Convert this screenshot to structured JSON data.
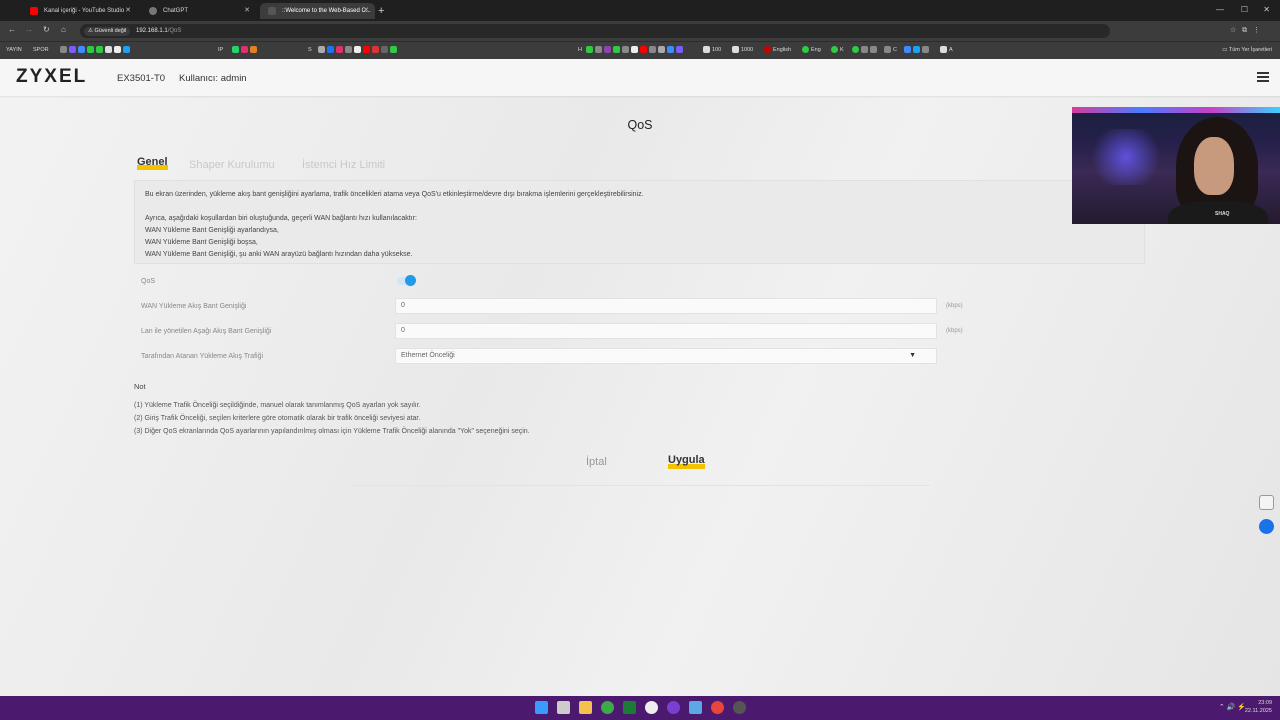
{
  "browser": {
    "tabs": [
      {
        "title": "Kanal içeriği - YouTube Studio",
        "color": "#ff0000"
      },
      {
        "title": "ChatGPT",
        "color": "#777777"
      },
      {
        "title": "::Welcome to the Web-Based C...",
        "color": "#555555"
      }
    ],
    "security_label": "Güvenli değil",
    "url_host": "192.168.1.1",
    "url_path": "/QoS",
    "bookmarks": [
      "YAYIN",
      "SPOR",
      "IP",
      "S",
      "H",
      "100",
      "1000",
      "English",
      "Eng",
      "K",
      "C",
      "A"
    ],
    "all_bookmarks_label": "Tüm Yer İşaretleri"
  },
  "header": {
    "logo": "ZYXEL",
    "model": "EX3501-T0",
    "user": "Kullanıcı: admin"
  },
  "page": {
    "title": "QoS",
    "tabs": [
      {
        "label": "Genel",
        "active": true
      },
      {
        "label": "Shaper Kurulumu",
        "active": false
      },
      {
        "label": "İstemci Hız Limiti",
        "active": false
      }
    ],
    "info": {
      "line1": "Bu ekran üzerinden, yükleme akış bant genişliğini ayarlama, trafik öncelikleri atama veya QoS'u etkinleştirme/devre dışı bırakma işlemlerini gerçekleştirebilirsiniz.",
      "line2": "Ayrıca, aşağıdaki koşullardan biri oluştuğunda, geçerli WAN bağlantı hızı kullanılacaktır:",
      "line3": "WAN Yükleme Bant Genişliği ayarlandıysa,",
      "line4": "WAN Yükleme Bant Genişliği boşsa,",
      "line5": "WAN Yükleme Bant Genişliği, şu anki WAN arayüzü bağlantı hızından daha yüksekse."
    },
    "form": {
      "qos_label": "QoS",
      "qos_enabled": true,
      "wan_label": "WAN Yükleme Akış Bant Genişliği",
      "wan_value": "0",
      "wan_unit": "(kbps)",
      "lan_label": "Lan ile yönetilen Aşağı Akış Bant Genişliği",
      "lan_value": "0",
      "lan_unit": "(kbps)",
      "assigned_label": "Tarafından Atanan Yükleme Akış Trafiği",
      "assigned_value": "Ethernet Önceliği"
    },
    "notes": {
      "title": "Not",
      "n1": "(1) Yükleme Trafik Önceliği seçildiğinde, manuel olarak tanımlanmış QoS ayarları yok sayılır.",
      "n2": "(2) Giriş Trafik Önceliği, seçilen kriterlere göre otomatik olarak bir trafik önceliği seviyesi atar.",
      "n3": "(3) Diğer QoS ekranlarında QoS ayarlarının yapılandırılmış olması için Yükleme Trafik Önceliği alanında \"Yok\" seçeneğini seçin."
    },
    "buttons": {
      "cancel": "İptal",
      "apply": "Uygula"
    },
    "accent": "#f3c300"
  },
  "webcam": {
    "caption": "SHAQ"
  },
  "taskbar": {
    "time": "23:09",
    "date": "22.11.2025"
  }
}
